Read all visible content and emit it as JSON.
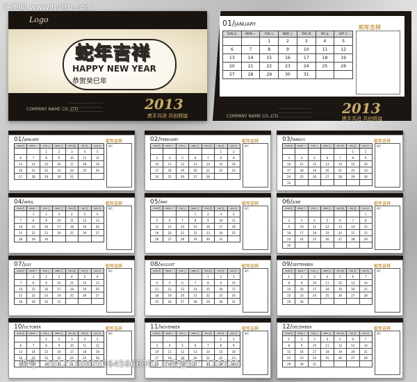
{
  "watermark": {
    "top": "汇图网 www.huitu.com",
    "bottom": "编号：20121108202645666392 上传者ID：132522"
  },
  "cover": {
    "logo": "Logo",
    "headline": "蛇年吉祥",
    "greeting": "HAPPY NEW YEAR",
    "subline": "恭贺癸巳年",
    "year": "2013",
    "slogan": "携手共进 共创辉煌",
    "company": "COMPANY NAME CO.,LTD"
  },
  "calendar": {
    "brand": "蛇年吉祥",
    "note_label": "备忘",
    "weekdays": [
      "SUN 日",
      "MON 一",
      "TUE 二",
      "WED 三",
      "THU 四",
      "FRI 五",
      "SAT 六"
    ],
    "months": [
      {
        "num": "01",
        "name": "JANUARY",
        "rows": [
          [
            "",
            "",
            "1",
            "2",
            "3",
            "4",
            "5"
          ],
          [
            "6",
            "7",
            "8",
            "9",
            "10",
            "11",
            "12"
          ],
          [
            "13",
            "14",
            "15",
            "16",
            "17",
            "18",
            "19"
          ],
          [
            "20",
            "21",
            "22",
            "23",
            "24",
            "25",
            "26"
          ],
          [
            "27",
            "28",
            "29",
            "30",
            "31",
            "",
            ""
          ]
        ]
      },
      {
        "num": "02",
        "name": "FEBRUARY",
        "rows": [
          [
            "",
            "",
            "",
            "",
            "",
            "1",
            "2"
          ],
          [
            "3",
            "4",
            "5",
            "6",
            "7",
            "8",
            "9"
          ],
          [
            "10",
            "11",
            "12",
            "13",
            "14",
            "15",
            "16"
          ],
          [
            "17",
            "18",
            "19",
            "20",
            "21",
            "22",
            "23"
          ],
          [
            "24",
            "25",
            "26",
            "27",
            "28",
            "",
            ""
          ]
        ]
      },
      {
        "num": "03",
        "name": "MARCH",
        "rows": [
          [
            "",
            "",
            "",
            "",
            "",
            "1",
            "2"
          ],
          [
            "3",
            "4",
            "5",
            "6",
            "7",
            "8",
            "9"
          ],
          [
            "10",
            "11",
            "12",
            "13",
            "14",
            "15",
            "16"
          ],
          [
            "17",
            "18",
            "19",
            "20",
            "21",
            "22",
            "23"
          ],
          [
            "24",
            "25",
            "26",
            "27",
            "28",
            "29",
            "30"
          ],
          [
            "31",
            "",
            "",
            "",
            "",
            "",
            ""
          ]
        ]
      },
      {
        "num": "04",
        "name": "APRIL",
        "rows": [
          [
            "",
            "1",
            "2",
            "3",
            "4",
            "5",
            "6"
          ],
          [
            "7",
            "8",
            "9",
            "10",
            "11",
            "12",
            "13"
          ],
          [
            "14",
            "15",
            "16",
            "17",
            "18",
            "19",
            "20"
          ],
          [
            "21",
            "22",
            "23",
            "24",
            "25",
            "26",
            "27"
          ],
          [
            "28",
            "29",
            "30",
            "",
            "",
            "",
            ""
          ]
        ]
      },
      {
        "num": "05",
        "name": "MAY",
        "rows": [
          [
            "",
            "",
            "",
            "1",
            "2",
            "3",
            "4"
          ],
          [
            "5",
            "6",
            "7",
            "8",
            "9",
            "10",
            "11"
          ],
          [
            "12",
            "13",
            "14",
            "15",
            "16",
            "17",
            "18"
          ],
          [
            "19",
            "20",
            "21",
            "22",
            "23",
            "24",
            "25"
          ],
          [
            "26",
            "27",
            "28",
            "29",
            "30",
            "31",
            ""
          ]
        ]
      },
      {
        "num": "06",
        "name": "JUNE",
        "rows": [
          [
            "",
            "",
            "",
            "",
            "",
            "",
            "1"
          ],
          [
            "2",
            "3",
            "4",
            "5",
            "6",
            "7",
            "8"
          ],
          [
            "9",
            "10",
            "11",
            "12",
            "13",
            "14",
            "15"
          ],
          [
            "16",
            "17",
            "18",
            "19",
            "20",
            "21",
            "22"
          ],
          [
            "23",
            "24",
            "25",
            "26",
            "27",
            "28",
            "29"
          ],
          [
            "30",
            "",
            "",
            "",
            "",
            "",
            ""
          ]
        ]
      },
      {
        "num": "07",
        "name": "JULY",
        "rows": [
          [
            "",
            "1",
            "2",
            "3",
            "4",
            "5",
            "6"
          ],
          [
            "7",
            "8",
            "9",
            "10",
            "11",
            "12",
            "13"
          ],
          [
            "14",
            "15",
            "16",
            "17",
            "18",
            "19",
            "20"
          ],
          [
            "21",
            "22",
            "23",
            "24",
            "25",
            "26",
            "27"
          ],
          [
            "28",
            "29",
            "30",
            "31",
            "",
            "",
            ""
          ]
        ]
      },
      {
        "num": "08",
        "name": "AUGUST",
        "rows": [
          [
            "",
            "",
            "",
            "",
            "1",
            "2",
            "3"
          ],
          [
            "4",
            "5",
            "6",
            "7",
            "8",
            "9",
            "10"
          ],
          [
            "11",
            "12",
            "13",
            "14",
            "15",
            "16",
            "17"
          ],
          [
            "18",
            "19",
            "20",
            "21",
            "22",
            "23",
            "24"
          ],
          [
            "25",
            "26",
            "27",
            "28",
            "29",
            "30",
            "31"
          ]
        ]
      },
      {
        "num": "09",
        "name": "SEPTEMBER",
        "rows": [
          [
            "1",
            "2",
            "3",
            "4",
            "5",
            "6",
            "7"
          ],
          [
            "8",
            "9",
            "10",
            "11",
            "12",
            "13",
            "14"
          ],
          [
            "15",
            "16",
            "17",
            "18",
            "19",
            "20",
            "21"
          ],
          [
            "22",
            "23",
            "24",
            "25",
            "26",
            "27",
            "28"
          ],
          [
            "29",
            "30",
            "",
            "",
            "",
            "",
            ""
          ]
        ]
      },
      {
        "num": "10",
        "name": "OCTOBER",
        "rows": [
          [
            "",
            "",
            "1",
            "2",
            "3",
            "4",
            "5"
          ],
          [
            "6",
            "7",
            "8",
            "9",
            "10",
            "11",
            "12"
          ],
          [
            "13",
            "14",
            "15",
            "16",
            "17",
            "18",
            "19"
          ],
          [
            "20",
            "21",
            "22",
            "23",
            "24",
            "25",
            "26"
          ],
          [
            "27",
            "28",
            "29",
            "30",
            "31",
            "",
            ""
          ]
        ]
      },
      {
        "num": "11",
        "name": "NOVEMBER",
        "rows": [
          [
            "",
            "",
            "",
            "",
            "",
            "1",
            "2"
          ],
          [
            "3",
            "4",
            "5",
            "6",
            "7",
            "8",
            "9"
          ],
          [
            "10",
            "11",
            "12",
            "13",
            "14",
            "15",
            "16"
          ],
          [
            "17",
            "18",
            "19",
            "20",
            "21",
            "22",
            "23"
          ],
          [
            "24",
            "25",
            "26",
            "27",
            "28",
            "29",
            "30"
          ]
        ]
      },
      {
        "num": "12",
        "name": "DECEMBER",
        "rows": [
          [
            "1",
            "2",
            "3",
            "4",
            "5",
            "6",
            "7"
          ],
          [
            "8",
            "9",
            "10",
            "11",
            "12",
            "13",
            "14"
          ],
          [
            "15",
            "16",
            "17",
            "18",
            "19",
            "20",
            "21"
          ],
          [
            "22",
            "23",
            "24",
            "25",
            "26",
            "27",
            "28"
          ],
          [
            "29",
            "30",
            "31",
            "",
            "",
            "",
            ""
          ]
        ]
      }
    ]
  }
}
